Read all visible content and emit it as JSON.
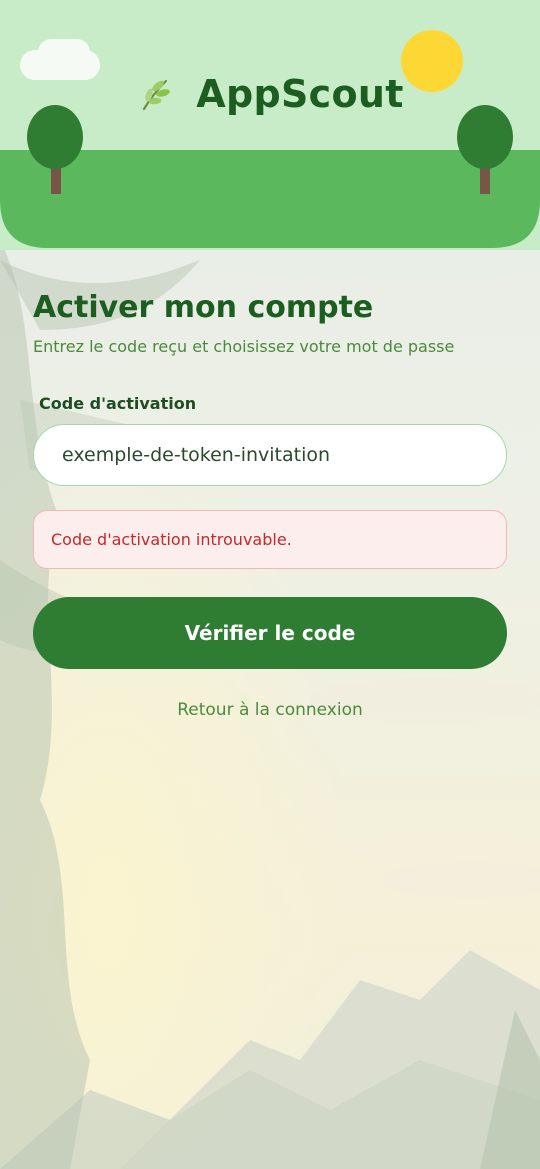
{
  "app": {
    "name": "AppScout",
    "logo_icon": "leaf-icon"
  },
  "form": {
    "title": "Activer mon compte",
    "subtitle": "Entrez le code reçu et choisissez votre mot de passe",
    "code_label": "Code d'activation",
    "code_value": "exemple-de-token-invitation",
    "error_message": "Code d'activation introuvable.",
    "submit_label": "Vérifier le code",
    "back_link": "Retour à la connexion"
  },
  "colors": {
    "primary": "#2e7d32",
    "title": "#1b5e20",
    "hill": "#5cb85c",
    "sky": "#c8ecc8",
    "sun": "#fdd835",
    "error": "#c62828"
  }
}
